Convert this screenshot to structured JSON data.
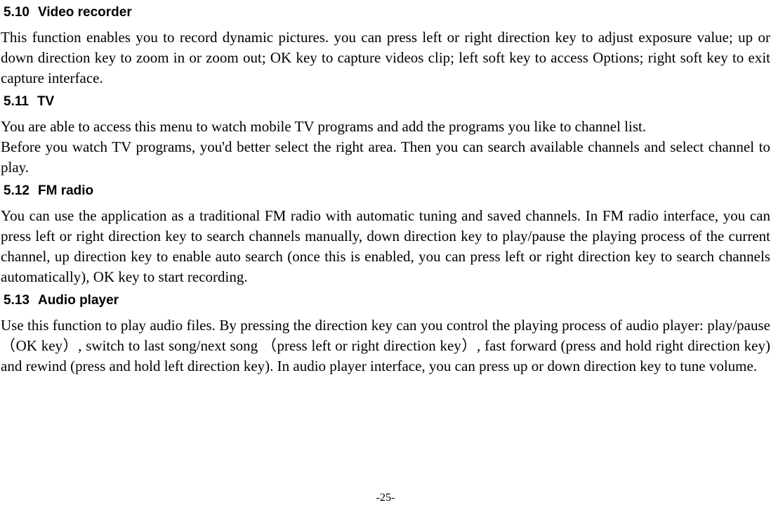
{
  "sections": {
    "s510": {
      "num": "5.10",
      "title": "Video recorder"
    },
    "s511": {
      "num": "5.11",
      "title": "TV"
    },
    "s512": {
      "num": "5.12",
      "title": "FM radio"
    },
    "s513": {
      "num": "5.13",
      "title": "Audio player"
    }
  },
  "paragraphs": {
    "p510": "This function enables you to record dynamic pictures. you can press left or right direction key to adjust exposure value; up or down direction key to zoom in or zoom out; OK key to capture videos clip; left soft key to access Options; right soft key to exit capture interface.",
    "p511a": "You are able to access this menu to watch mobile TV programs and add the programs you like to channel list.",
    "p511b": "Before you watch TV programs, you'd better select the right area. Then you can search available channels and select channel to play.",
    "p512": "You can use the application as a traditional FM radio with automatic tuning and saved channels. In FM radio interface, you can press left or right direction key to search channels manually, down direction key to play/pause the playing process of the current channel, up direction key to enable auto search (once this is enabled, you can press left or right direction key to search channels automatically), OK key to start recording.",
    "p513": "Use this function to play audio files. By pressing the direction key can you control the playing process of audio player: play/pause（OK key）, switch to last song/next song （press left or right direction key）, fast forward (press and hold right direction key) and rewind (press and hold left direction key). In audio player interface, you can press up or down direction key to tune volume."
  },
  "footer": {
    "page_number": "-25-"
  }
}
